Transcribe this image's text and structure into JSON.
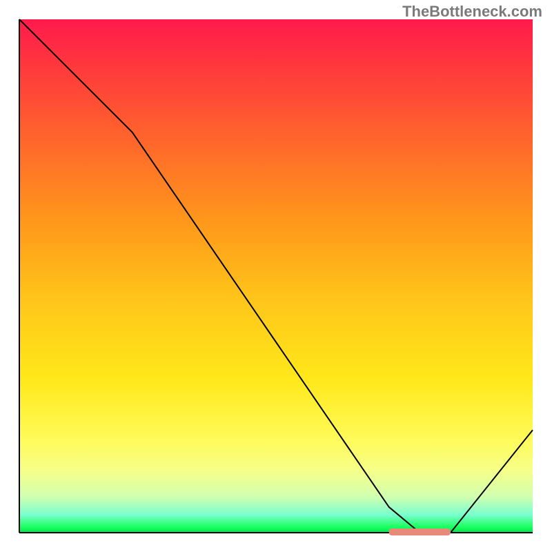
{
  "watermark": "TheBottleneck.com",
  "chart_data": {
    "type": "line",
    "title": "",
    "xlabel": "",
    "ylabel": "",
    "xlim": [
      0,
      100
    ],
    "ylim": [
      0,
      100
    ],
    "series": [
      {
        "name": "bottleneck-curve",
        "x": [
          0,
          22,
          72,
          78,
          84,
          100
        ],
        "values": [
          100,
          78,
          5,
          0,
          0,
          20
        ]
      }
    ],
    "marker": {
      "name": "highlight-region",
      "x_start": 72,
      "x_end": 84,
      "y": 0,
      "color": "#e88a7a"
    },
    "gradient_stops": [
      {
        "pos": 0,
        "color": "#ff1a4d"
      },
      {
        "pos": 0.55,
        "color": "#ffc61a"
      },
      {
        "pos": 0.82,
        "color": "#fffb5a"
      },
      {
        "pos": 1.0,
        "color": "#00e05a"
      }
    ]
  }
}
